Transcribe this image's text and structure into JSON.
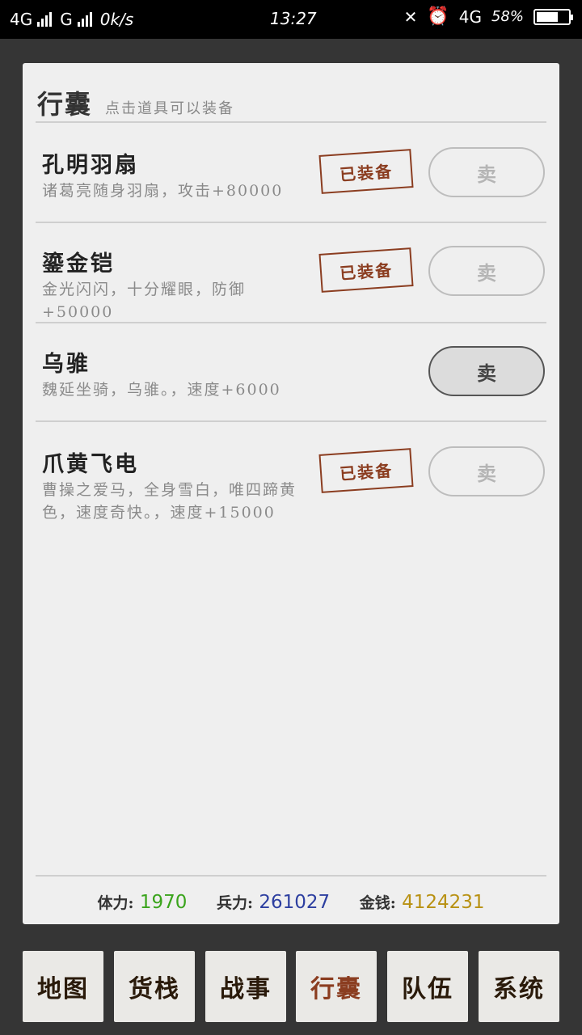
{
  "status_bar": {
    "network_left": "4G",
    "network_left2": "G",
    "speed": "0k/s",
    "time": "13:27",
    "network_right": "4G",
    "battery": "58%"
  },
  "panel": {
    "title": "行囊",
    "subtitle": "点击道具可以装备"
  },
  "items": [
    {
      "name": "孔明羽扇",
      "desc": "诸葛亮随身羽扇，攻击+80000",
      "equipped_label": "已装备",
      "equipped": true,
      "sell_label": "卖"
    },
    {
      "name": "鎏金铠",
      "desc": "金光闪闪，十分耀眼，防御+50000",
      "equipped_label": "已装备",
      "equipped": true,
      "sell_label": "卖"
    },
    {
      "name": "乌骓",
      "desc": "魏延坐骑，乌骓。，速度+6000",
      "equipped_label": "",
      "equipped": false,
      "sell_label": "卖"
    },
    {
      "name": "爪黄飞电",
      "desc": "曹操之爱马，全身雪白，唯四蹄黄色，速度奇快。，速度+15000",
      "equipped_label": "已装备",
      "equipped": true,
      "sell_label": "卖"
    }
  ],
  "stats": {
    "stamina_label": "体力:",
    "stamina_value": "1970",
    "troops_label": "兵力:",
    "troops_value": "261027",
    "gold_label": "金钱:",
    "gold_value": "4124231"
  },
  "nav": {
    "map": "地图",
    "shop": "货栈",
    "battle": "战事",
    "bag": "行囊",
    "team": "队伍",
    "system": "系统"
  },
  "colors": {
    "stamp": "#8b3d20",
    "stamina": "#3aa41c",
    "troops": "#2d3fa0",
    "gold": "#b89112"
  }
}
